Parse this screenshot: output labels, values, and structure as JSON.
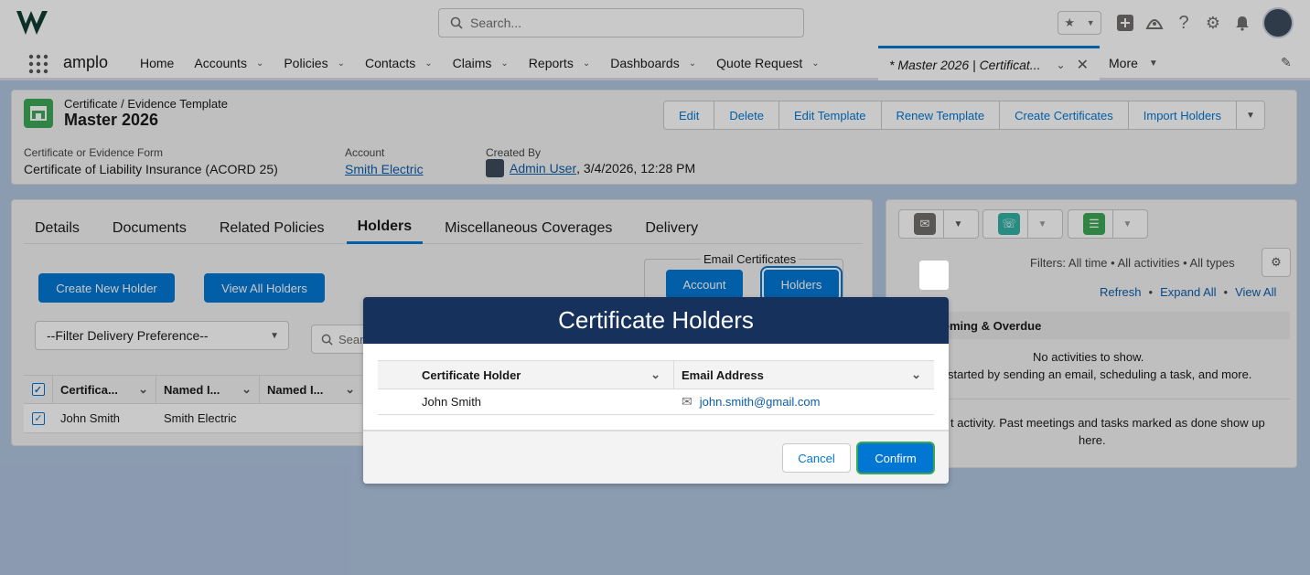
{
  "header": {
    "search_placeholder": "Search...",
    "app_name": "amplo"
  },
  "nav": {
    "items": [
      {
        "label": "Home",
        "has_menu": false
      },
      {
        "label": "Accounts",
        "has_menu": true
      },
      {
        "label": "Policies",
        "has_menu": true
      },
      {
        "label": "Contacts",
        "has_menu": true
      },
      {
        "label": "Claims",
        "has_menu": true
      },
      {
        "label": "Reports",
        "has_menu": true
      },
      {
        "label": "Dashboards",
        "has_menu": true
      },
      {
        "label": "Quote Request",
        "has_menu": true
      }
    ],
    "active_tab": "* Master 2026 | Certificat...",
    "more_label": "More"
  },
  "record": {
    "type_label": "Certificate / Evidence Template",
    "title": "Master 2026",
    "actions": [
      "Edit",
      "Delete",
      "Edit Template",
      "Renew Template",
      "Create Certificates",
      "Import Holders"
    ],
    "fields": {
      "form_label": "Certificate or Evidence Form",
      "form_value": "Certificate of Liability Insurance (ACORD 25)",
      "account_label": "Account",
      "account_value": "Smith Electric",
      "created_label": "Created By",
      "created_user": "Admin User",
      "created_date": ", 3/4/2026, 12:28 PM"
    }
  },
  "tabs": [
    "Details",
    "Documents",
    "Related Policies",
    "Holders",
    "Miscellaneous Coverages",
    "Delivery"
  ],
  "active_tab_index": 3,
  "holders": {
    "create_btn": "Create New Holder",
    "view_all_btn": "View All Holders",
    "email_legend": "Email Certificates",
    "email_account_btn": "Account",
    "email_holders_btn": "Holders",
    "filter_placeholder": "--Filter Delivery Preference--",
    "search_placeholder": "Sear",
    "columns": [
      "Certifica...",
      "Named I...",
      "Named I..."
    ],
    "rows": [
      {
        "holder": "John Smith",
        "named": "Smith Electric"
      }
    ]
  },
  "activity": {
    "filters_text": "Filters: All time • All activities • All types",
    "refresh": "Refresh",
    "expand_all": "Expand All",
    "view_all": "View All",
    "upcoming_heading": "oming & Overdue",
    "empty_title": "No activities to show.",
    "empty_sub": "started by sending an email, scheduling a task, and more.",
    "past_text": "t activity. Past meetings and tasks marked as done show up",
    "past_text2": "here."
  },
  "modal": {
    "title": "Certificate Holders",
    "col_holder": "Certificate Holder",
    "col_email": "Email Address",
    "rows": [
      {
        "holder": "John Smith",
        "email": "john.smith@gmail.com"
      }
    ],
    "cancel": "Cancel",
    "confirm": "Confirm"
  },
  "colors": {
    "brand": "#0176d3",
    "modal_header": "#16325c",
    "record_icon": "#3ba755",
    "email_icon": "#706e6b",
    "call_icon": "#30b2a6",
    "task_icon": "#3ba755"
  }
}
